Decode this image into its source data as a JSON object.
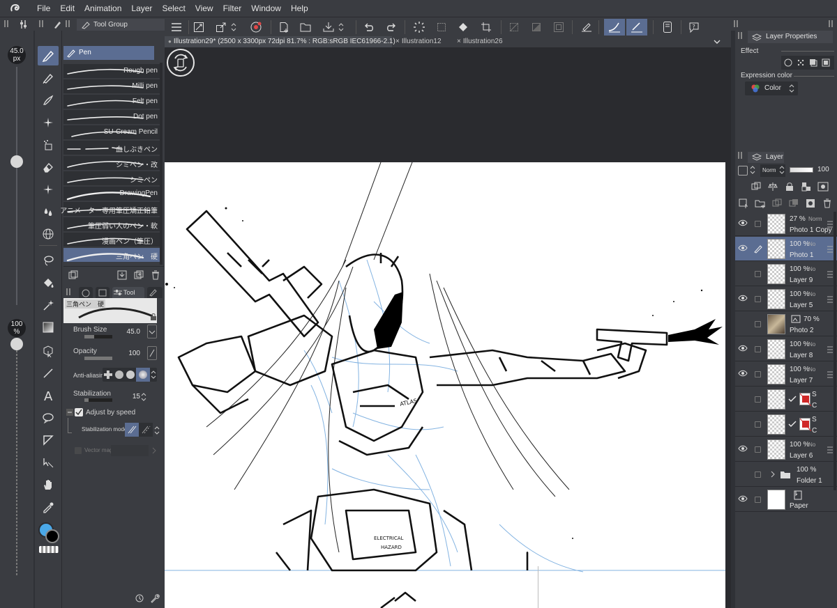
{
  "menu": [
    "File",
    "Edit",
    "Animation",
    "Layer",
    "Select",
    "View",
    "Filter",
    "Window",
    "Help"
  ],
  "brush_size_indicator": "45.0",
  "brush_size_unit": "px",
  "zoom_indicator": "100",
  "zoom_unit": "%",
  "tool_group": {
    "title": "Tool Group",
    "group_name": "Pen",
    "brushes": [
      "Rough pen",
      "Milli pen",
      "Felt pen",
      "Dot pen",
      "SU-Cream Pencil",
      "血しぶきペン",
      "シミペン・改",
      "シミペン",
      "DrawingPen",
      "アニメーター専用筆圧矯正鉛筆",
      "筆圧弱い人のペン・軟",
      "漫画ペン（筆圧）",
      "三角ペン　硬"
    ],
    "selected_index": 12
  },
  "tool_property": {
    "tab_label": "Tool",
    "current_brush": "三角ペン　硬",
    "brush_size_label": "Brush Size",
    "brush_size_value": "45.0",
    "opacity_label": "Opacity",
    "opacity_value": "100",
    "anti_aliasing_label": "Anti-aliasing",
    "stabilization_label": "Stabilization",
    "stabilization_value": "15",
    "adjust_by_speed_label": "Adjust by speed",
    "adjust_by_speed_checked": true,
    "stabilization_mode_label": "Stabilization mode",
    "vector_magnet_label": "Vector mag"
  },
  "tabs": [
    {
      "label": "Illustration29* (2500 x 3300px 72dpi 81.7% : RGB:sRGB IEC61966-2.1)",
      "active": true
    },
    {
      "label": "Illustration12",
      "active": false
    },
    {
      "label": "Illustration26",
      "active": false
    }
  ],
  "layer_properties": {
    "title": "Layer Properties",
    "effect_label": "Effect",
    "expression_color_label": "Expression color",
    "expression_color_value": "Color"
  },
  "layer_panel": {
    "title": "Layer",
    "blend_mode": "Norm",
    "opacity": "100",
    "layers": [
      {
        "opacity": "27 %",
        "blend": "Norm",
        "name": "Photo 1 Copy",
        "visible": true,
        "selected": false,
        "kind": "raster"
      },
      {
        "opacity": "100 %",
        "blend": "No",
        "name": "Photo 1",
        "visible": true,
        "selected": true,
        "kind": "raster"
      },
      {
        "opacity": "100 %",
        "blend": "No",
        "name": "Layer 9",
        "visible": false,
        "selected": false,
        "kind": "raster"
      },
      {
        "opacity": "100 %",
        "blend": "No",
        "name": "Layer 5",
        "visible": true,
        "selected": false,
        "kind": "raster"
      },
      {
        "opacity": "70 %",
        "blend": "",
        "name": "Photo 2",
        "visible": false,
        "selected": false,
        "kind": "photo"
      },
      {
        "opacity": "100 %",
        "blend": "No",
        "name": "Layer 8",
        "visible": true,
        "selected": false,
        "kind": "raster"
      },
      {
        "opacity": "100 %",
        "blend": "No",
        "name": "Layer 7",
        "visible": true,
        "selected": false,
        "kind": "raster"
      },
      {
        "opacity": "S",
        "blend": "",
        "name": "C",
        "visible": false,
        "selected": false,
        "kind": "masked"
      },
      {
        "opacity": "S",
        "blend": "",
        "name": "C",
        "visible": false,
        "selected": false,
        "kind": "masked"
      },
      {
        "opacity": "100 %",
        "blend": "No",
        "name": "Layer 6",
        "visible": true,
        "selected": false,
        "kind": "raster"
      },
      {
        "opacity": "100 %",
        "blend": "",
        "name": "Folder 1",
        "visible": false,
        "selected": false,
        "kind": "folder"
      },
      {
        "opacity": "",
        "blend": "",
        "name": "Paper",
        "visible": true,
        "selected": false,
        "kind": "paper"
      }
    ]
  },
  "colors": {
    "accent": "#5b6d92",
    "panel": "#3a3c41",
    "background": "#2f3136",
    "main_color": "#4aa8e8",
    "sub_color": "#000000"
  }
}
